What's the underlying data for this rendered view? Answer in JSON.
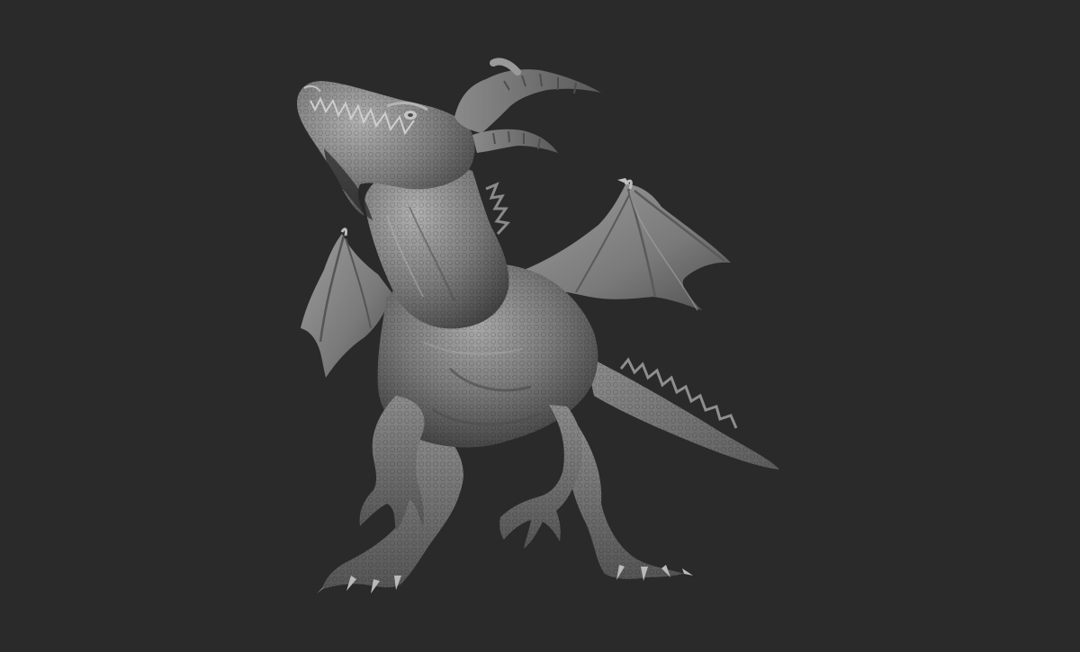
{
  "viewport": {
    "background_color": "#2a2a2a",
    "subject": "dragon-sculpt",
    "material_colors": {
      "base": "#6e6e6e",
      "light": "#9a9a9a",
      "highlight": "#b8b8b8",
      "shadow": "#3c3c3c",
      "deep_shadow": "#262626"
    }
  }
}
